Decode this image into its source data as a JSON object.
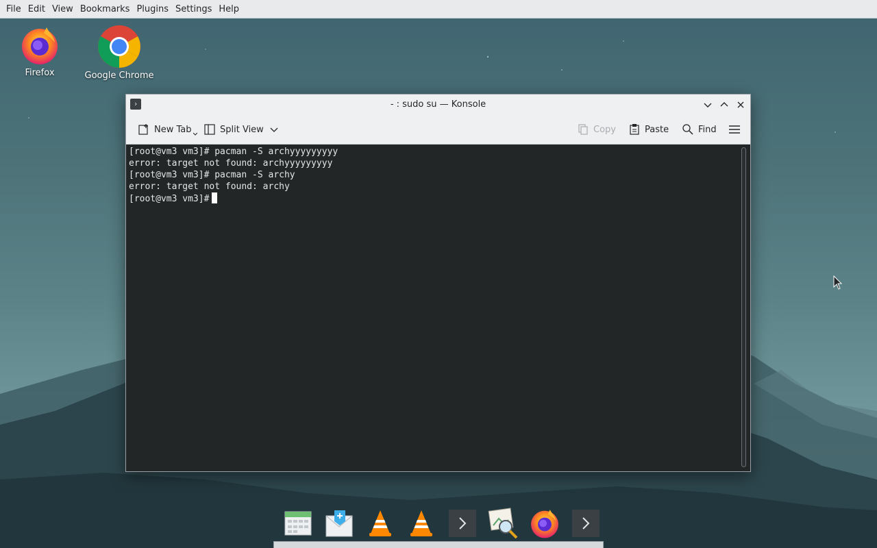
{
  "menubar": {
    "items": [
      "File",
      "Edit",
      "View",
      "Bookmarks",
      "Plugins",
      "Settings",
      "Help"
    ]
  },
  "desktop": {
    "icons": [
      {
        "label": "Firefox",
        "icon": "firefox-icon"
      },
      {
        "label": "Google Chrome",
        "icon": "chrome-icon"
      }
    ]
  },
  "window": {
    "title": "- : sudo su — Konsole",
    "toolbar": {
      "new_tab": "New Tab",
      "split_view": "Split View",
      "copy": "Copy",
      "paste": "Paste",
      "find": "Find"
    },
    "terminal": {
      "lines": [
        "[root@vm3 vm3]# pacman -S archyyyyyyyyy",
        "error: target not found: archyyyyyyyyy",
        "[root@vm3 vm3]# pacman -S archy",
        "error: target not found: archy",
        "[root@vm3 vm3]#"
      ]
    }
  },
  "dock": {
    "items": [
      "calendar-icon",
      "mail-icon",
      "vlc-icon",
      "vlc-icon",
      "terminal-icon",
      "image-viewer-icon",
      "firefox-icon",
      "terminal-icon"
    ]
  },
  "colors": {
    "terminal_bg": "#232627",
    "terminal_fg": "#e4e6e7",
    "chrome_bg": "#eff0f1"
  }
}
